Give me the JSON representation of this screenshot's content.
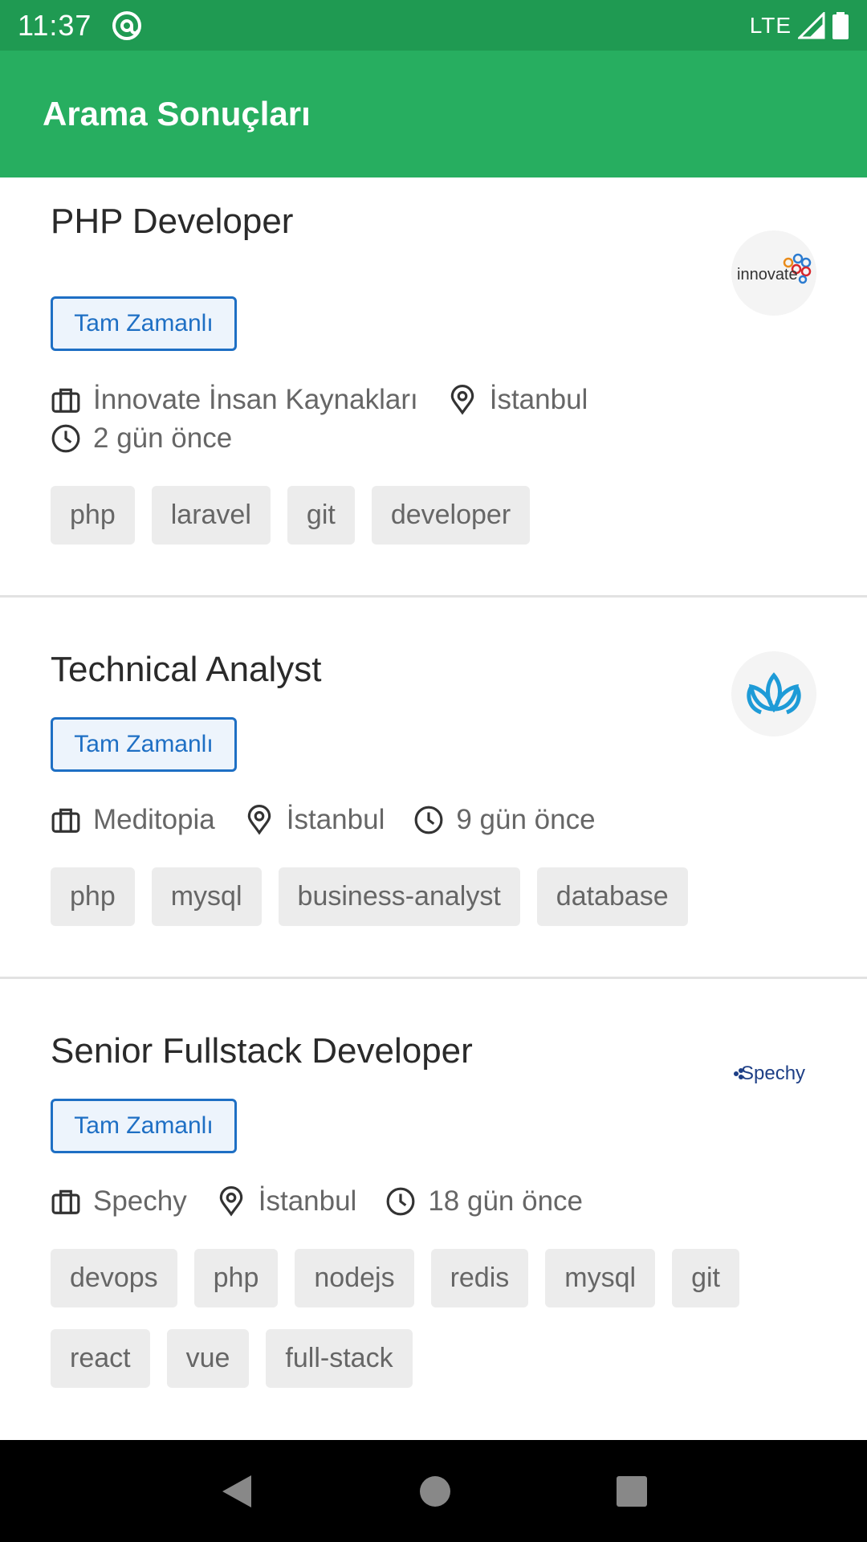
{
  "status_bar": {
    "time": "11:37",
    "network": "LTE"
  },
  "app_bar": {
    "title": "Arama Sonuçları"
  },
  "jobs": [
    {
      "title": "PHP Developer",
      "employment_type": "Tam Zamanlı",
      "company": "İnnovate İnsan Kaynakları",
      "location": "İstanbul",
      "posted": "2 gün önce",
      "logo_text": "innovate",
      "tags": [
        "php",
        "laravel",
        "git",
        "developer"
      ]
    },
    {
      "title": "Technical Analyst",
      "employment_type": "Tam Zamanlı",
      "company": "Meditopia",
      "location": "İstanbul",
      "posted": "9 gün önce",
      "logo_text": "",
      "tags": [
        "php",
        "mysql",
        "business-analyst",
        "database"
      ]
    },
    {
      "title": "Senior Fullstack Developer",
      "employment_type": "Tam Zamanlı",
      "company": "Spechy",
      "location": "İstanbul",
      "posted": "18 gün önce",
      "logo_text": "Spechy",
      "tags": [
        "devops",
        "php",
        "nodejs",
        "redis",
        "mysql",
        "git",
        "react",
        "vue",
        "full-stack"
      ]
    }
  ],
  "colors": {
    "status_bar": "#1f9a52",
    "app_bar": "#27ae60",
    "badge": "#1e6fc4",
    "tag_bg": "#ececec"
  },
  "icons": [
    "briefcase-icon",
    "location-pin-icon",
    "clock-icon",
    "back-icon",
    "home-icon",
    "recents-icon"
  ]
}
